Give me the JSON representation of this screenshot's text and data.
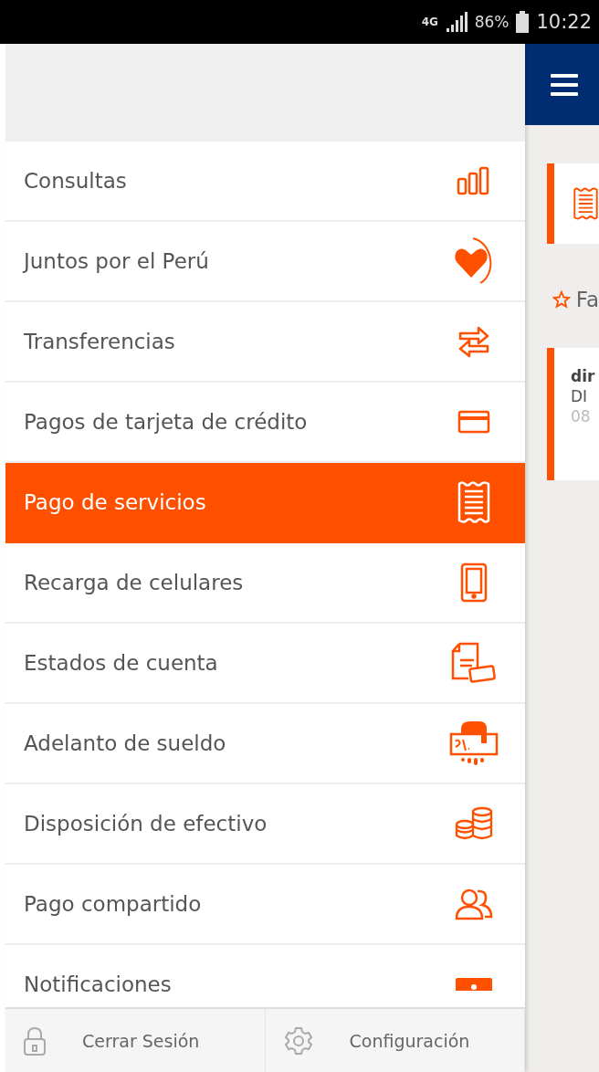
{
  "status_bar": {
    "network": "4G",
    "battery": "86%",
    "time": "10:22"
  },
  "menu": [
    {
      "label": "Consultas",
      "selected": false
    },
    {
      "label": "Juntos por el Perú",
      "selected": false
    },
    {
      "label": "Transferencias",
      "selected": false
    },
    {
      "label": "Pagos de tarjeta de crédito",
      "selected": false
    },
    {
      "label": "Pago de servicios",
      "selected": true
    },
    {
      "label": "Recarga de celulares",
      "selected": false
    },
    {
      "label": "Estados de cuenta",
      "selected": false
    },
    {
      "label": "Adelanto de sueldo",
      "selected": false
    },
    {
      "label": "Disposición de efectivo",
      "selected": false
    },
    {
      "label": "Pago compartido",
      "selected": false
    },
    {
      "label": "Notificaciones",
      "selected": false
    }
  ],
  "footer": [
    {
      "label": "Cerrar Sesión"
    },
    {
      "label": "Configuración"
    }
  ],
  "background": {
    "section_title": "Fa",
    "card_title": "dir",
    "card_subtitle": "DI",
    "card_number": "08"
  }
}
